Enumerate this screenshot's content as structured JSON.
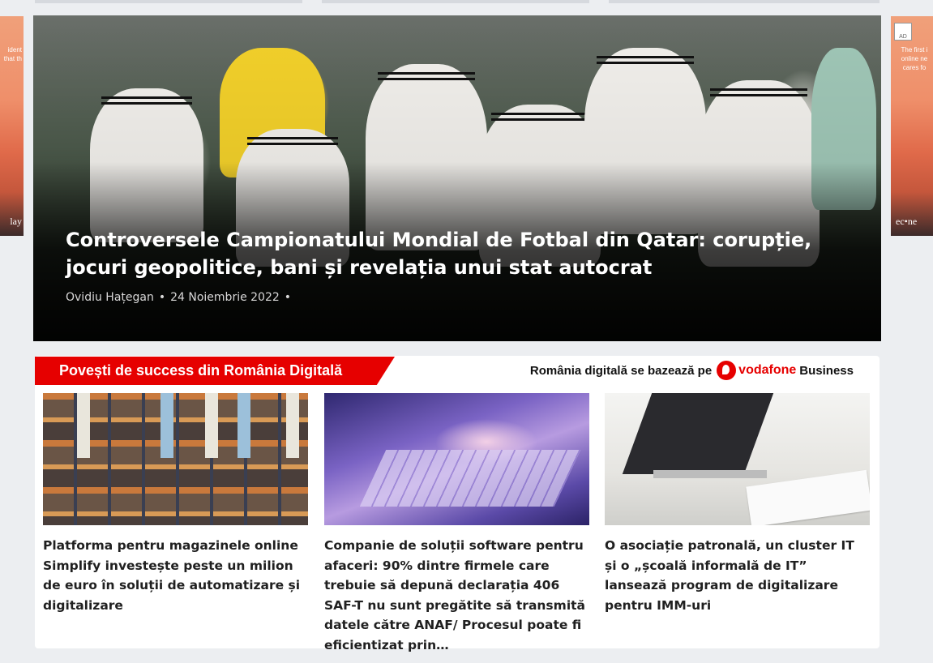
{
  "hero": {
    "title": "Controversele Campionatului Mondial de Fotbal din Qatar: corupție, jocuri geopolitice, bani și revelația unui stat autocrat",
    "author": "Ovidiu Hațegan",
    "date": "24 Noiembrie 2022",
    "separator": "•"
  },
  "ads": {
    "left": {
      "text": "ident that th",
      "brand": "lay"
    },
    "right": {
      "text": "The first i online ne cares fo",
      "brand": "ec•ne",
      "badge": "AD"
    }
  },
  "section": {
    "heading": "Povești de success din România Digitală",
    "sponsor_text": "România digitală se bazează pe",
    "sponsor_brand": "vodafone",
    "sponsor_suffix": "Business"
  },
  "cards": [
    {
      "title": "Platforma pentru magazinele online Simplify investește peste un milion de euro în soluții de automatizare și digitalizare"
    },
    {
      "title": "Companie de soluții software pentru afaceri: 90% dintre firmele care trebuie să depună declarația 406 SAF-T nu sunt pregătite să transmită datele către ANAF/ Procesul poate fi eficientizat prin…"
    },
    {
      "title": "O asociație patronală, un cluster IT și o „școală informală de IT” lansează program de digitalizare pentru IMM-uri"
    }
  ]
}
